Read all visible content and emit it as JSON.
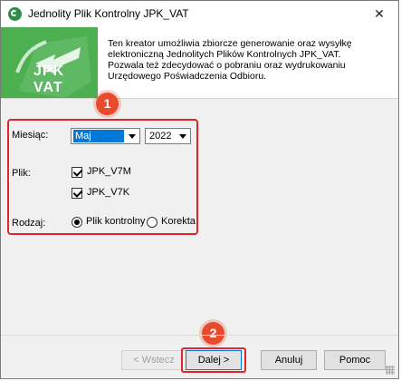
{
  "window": {
    "title": "Jednolity Plik Kontrolny JPK_VAT"
  },
  "banner": {
    "text": "JPK VAT"
  },
  "description": "Ten kreator umożliwia zbiorcze generowanie oraz wysyłkę elektroniczną Jednolitych Plików Kontrolnych JPK_VAT. Pozwala też zdecydować o pobraniu oraz wydrukowaniu Urzędowego Poświadczenia Odbioru.",
  "form": {
    "month_label": "Miesiąc:",
    "month_value": "Maj",
    "year_value": "2022",
    "file_label": "Plik:",
    "files": [
      "JPK_V7M",
      "JPK_V7K"
    ],
    "type_label": "Rodzaj:",
    "types": [
      "Plik kontrolny",
      "Korekta"
    ]
  },
  "annotations": {
    "step1": "1",
    "step2": "2"
  },
  "buttons": {
    "back": "< Wstecz",
    "next": "Dalej >",
    "cancel": "Anuluj",
    "help": "Pomoc"
  },
  "colors": {
    "accent": "#e0262a",
    "badge": "#e84a2e",
    "banner": "#3fa64a",
    "selection": "#0078d7"
  }
}
